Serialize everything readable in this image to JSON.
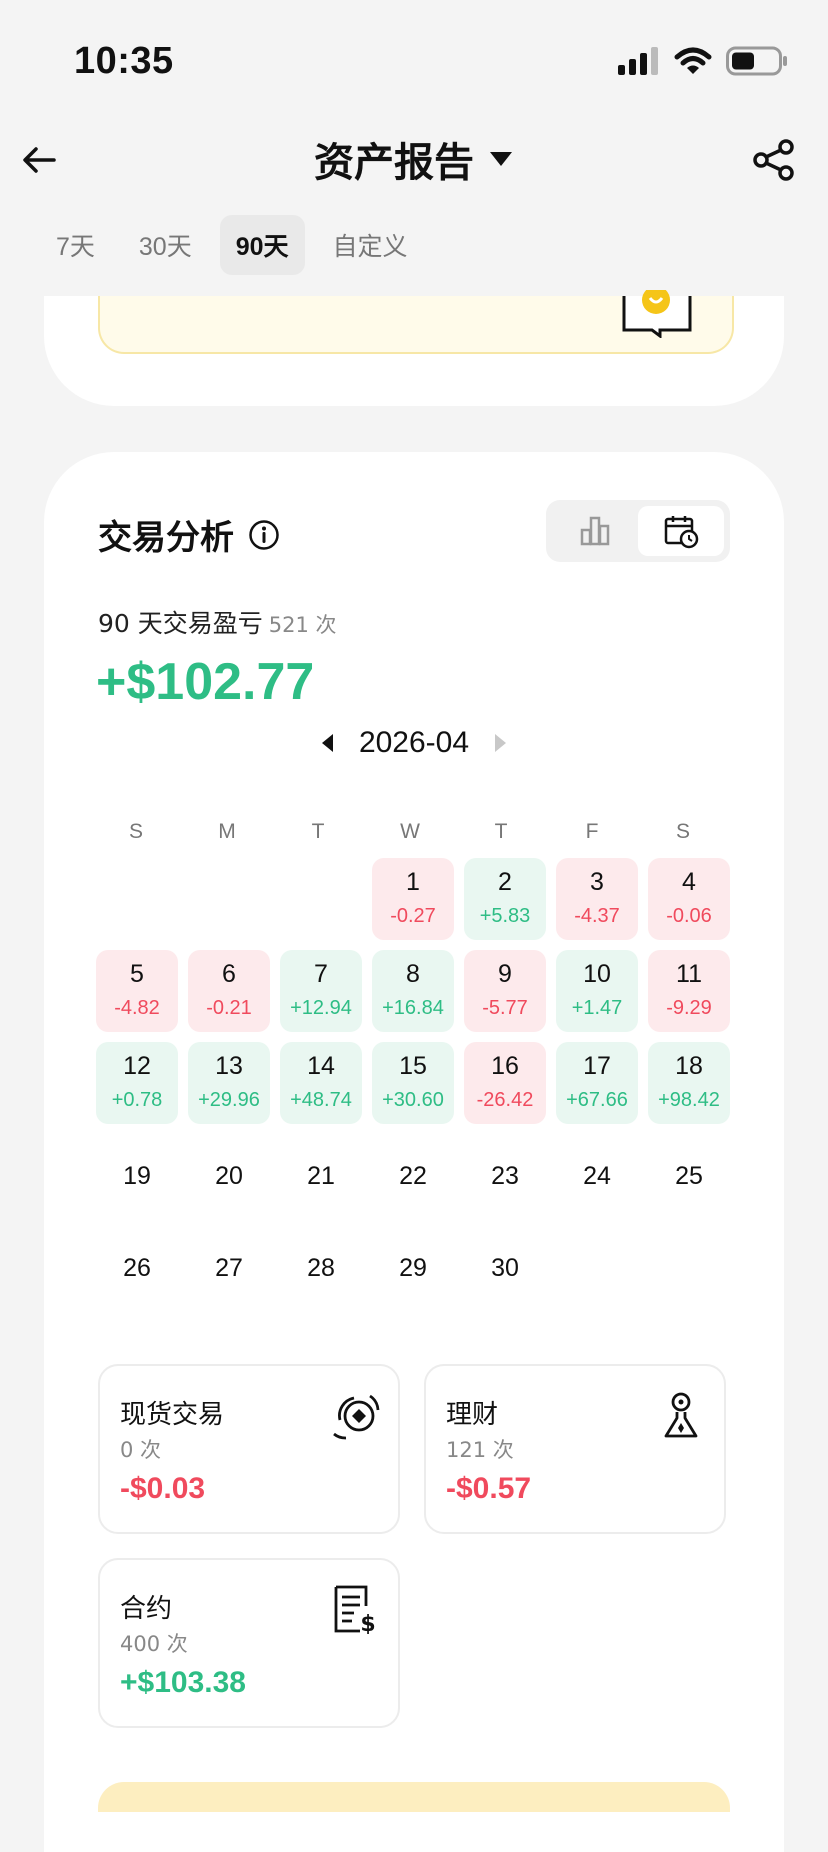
{
  "status_bar": {
    "time": "10:35"
  },
  "header": {
    "title": "资产报告"
  },
  "tabs": [
    {
      "label": "7天",
      "active": false
    },
    {
      "label": "30天",
      "active": false
    },
    {
      "label": "90天",
      "active": true
    },
    {
      "label": "自定义",
      "active": false
    }
  ],
  "analysis": {
    "title": "交易分析",
    "pnl_label": "90 天交易盈亏",
    "pnl_count": "521 次",
    "pnl_value": "+$102.77",
    "month": "2026-04"
  },
  "calendar": {
    "weekdays": [
      "S",
      "M",
      "T",
      "W",
      "T",
      "F",
      "S"
    ],
    "days": [
      {
        "day": "1",
        "value": "-0.27",
        "type": "neg"
      },
      {
        "day": "2",
        "value": "+5.83",
        "type": "pos"
      },
      {
        "day": "3",
        "value": "-4.37",
        "type": "neg"
      },
      {
        "day": "4",
        "value": "-0.06",
        "type": "neg"
      },
      {
        "day": "5",
        "value": "-4.82",
        "type": "neg"
      },
      {
        "day": "6",
        "value": "-0.21",
        "type": "neg"
      },
      {
        "day": "7",
        "value": "+12.94",
        "type": "pos"
      },
      {
        "day": "8",
        "value": "+16.84",
        "type": "pos"
      },
      {
        "day": "9",
        "value": "-5.77",
        "type": "neg"
      },
      {
        "day": "10",
        "value": "+1.47",
        "type": "pos"
      },
      {
        "day": "11",
        "value": "-9.29",
        "type": "neg"
      },
      {
        "day": "12",
        "value": "+0.78",
        "type": "pos"
      },
      {
        "day": "13",
        "value": "+29.96",
        "type": "pos"
      },
      {
        "day": "14",
        "value": "+48.74",
        "type": "pos"
      },
      {
        "day": "15",
        "value": "+30.60",
        "type": "pos"
      },
      {
        "day": "16",
        "value": "-26.42",
        "type": "neg"
      },
      {
        "day": "17",
        "value": "+67.66",
        "type": "pos"
      },
      {
        "day": "18",
        "value": "+98.42",
        "type": "pos"
      },
      {
        "day": "19",
        "value": "",
        "type": "empty"
      },
      {
        "day": "20",
        "value": "",
        "type": "empty"
      },
      {
        "day": "21",
        "value": "",
        "type": "empty"
      },
      {
        "day": "22",
        "value": "",
        "type": "empty"
      },
      {
        "day": "23",
        "value": "",
        "type": "empty"
      },
      {
        "day": "24",
        "value": "",
        "type": "empty"
      },
      {
        "day": "25",
        "value": "",
        "type": "empty"
      },
      {
        "day": "26",
        "value": "",
        "type": "empty"
      },
      {
        "day": "27",
        "value": "",
        "type": "empty"
      },
      {
        "day": "28",
        "value": "",
        "type": "empty"
      },
      {
        "day": "29",
        "value": "",
        "type": "empty"
      },
      {
        "day": "30",
        "value": "",
        "type": "empty"
      }
    ]
  },
  "breakdown": {
    "spot": {
      "name": "现货交易",
      "count": "0 次",
      "amount": "-$0.03"
    },
    "earn": {
      "name": "理财",
      "count": "121 次",
      "amount": "-$0.57"
    },
    "futures": {
      "name": "合约",
      "count": "400 次",
      "amount": "+$103.38"
    }
  },
  "colors": {
    "positive": "#2ebd85",
    "negative": "#f04a5d",
    "positive_bg": "#e9f7f1",
    "negative_bg": "#fdeaec"
  }
}
